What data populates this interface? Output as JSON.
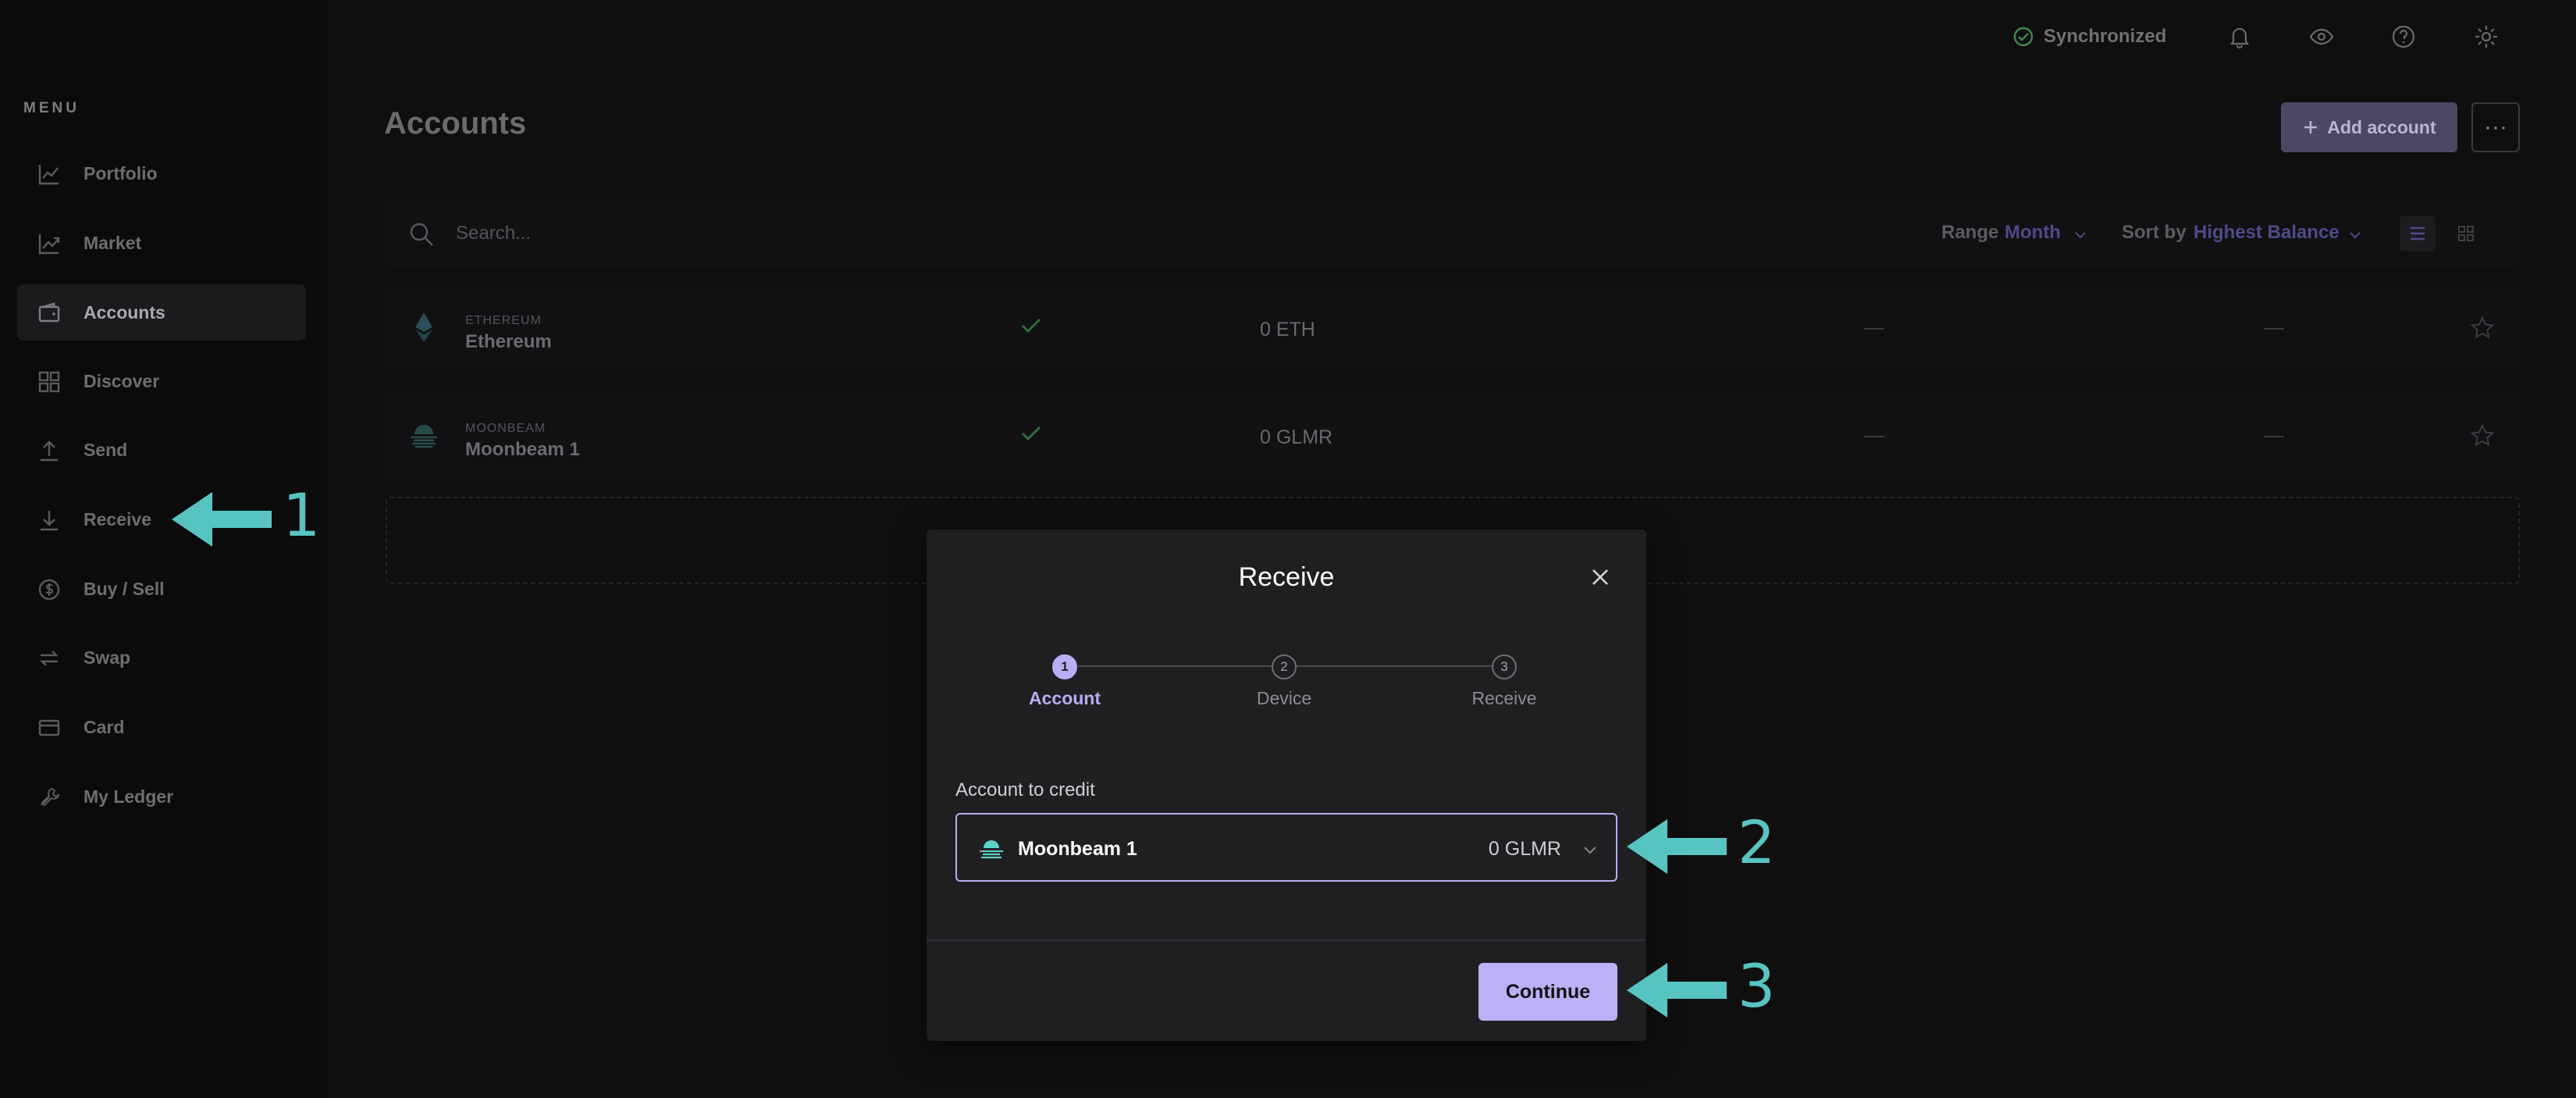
{
  "window": {
    "traffic_colors": [
      "#ee5f58",
      "#f4bd4f",
      "#5fc454"
    ]
  },
  "sidebar": {
    "menu_label": "MENU",
    "items": [
      {
        "label": "Portfolio",
        "icon": "chart-line-icon"
      },
      {
        "label": "Market",
        "icon": "market-trend-icon"
      },
      {
        "label": "Accounts",
        "icon": "wallet-icon",
        "active": true
      },
      {
        "label": "Discover",
        "icon": "grid-icon"
      },
      {
        "label": "Send",
        "icon": "upload-arrow-icon"
      },
      {
        "label": "Receive",
        "icon": "download-arrow-icon"
      },
      {
        "label": "Buy / Sell",
        "icon": "dollar-circle-icon"
      },
      {
        "label": "Swap",
        "icon": "swap-arrows-icon"
      },
      {
        "label": "Card",
        "icon": "card-icon"
      },
      {
        "label": "My Ledger",
        "icon": "tools-icon"
      }
    ]
  },
  "topbar": {
    "sync_label": "Synchronized",
    "icons": [
      "bell-icon",
      "eye-icon",
      "help-icon",
      "gear-icon"
    ]
  },
  "main": {
    "title": "Accounts",
    "add_account_label": "Add account",
    "more_label": "···",
    "search_placeholder": "Search...",
    "range_label": "Range",
    "range_value": "Month",
    "sort_label": "Sort by",
    "sort_value": "Highest Balance",
    "accounts": [
      {
        "currency": "ETHEREUM",
        "name": "Ethereum",
        "balance": "0 ETH"
      },
      {
        "currency": "MOONBEAM",
        "name": "Moonbeam 1",
        "balance": "0 GLMR"
      }
    ]
  },
  "modal": {
    "title": "Receive",
    "steps": [
      {
        "number": "1",
        "label": "Account",
        "active": true
      },
      {
        "number": "2",
        "label": "Device"
      },
      {
        "number": "3",
        "label": "Receive"
      }
    ],
    "credit_label": "Account to credit",
    "selected_account": "Moonbeam 1",
    "selected_balance": "0 GLMR",
    "continue_label": "Continue"
  },
  "annotations": {
    "labels": [
      "1",
      "2",
      "3"
    ],
    "color": "#58c4c2"
  },
  "colors": {
    "accent": "#bbb1f7",
    "success": "#3e9b4c",
    "annotation": "#58c4c2"
  }
}
